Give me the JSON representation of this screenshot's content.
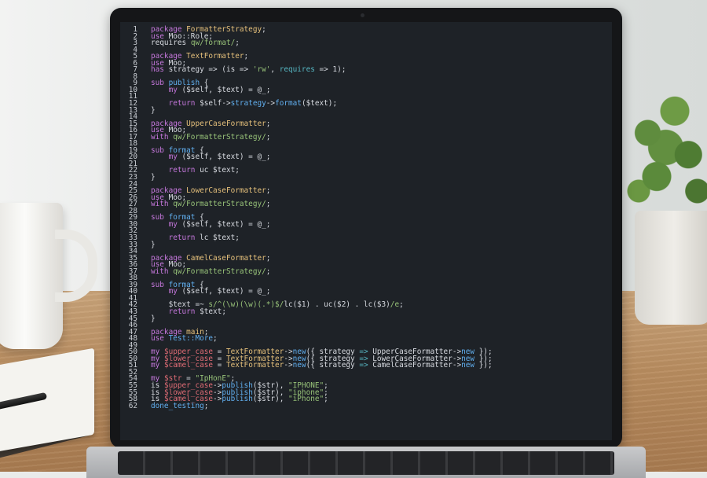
{
  "scene": {
    "objects": [
      "coffee-mug",
      "notebook",
      "pen",
      "potted-plant",
      "laptop"
    ]
  },
  "editor": {
    "theme": "dark",
    "background": "#1e2227",
    "colors": {
      "keyword": "#c678dd",
      "type": "#e5c07b",
      "string": "#98c379",
      "function": "#61afef",
      "variable": "#e06c75",
      "operator": "#56b6c2",
      "plain": "#d7dae0"
    },
    "lines": [
      {
        "n": "1",
        "segs": [
          [
            "kw",
            "package "
          ],
          [
            "ty",
            "FormatterStrategy"
          ],
          [
            "pl",
            ";"
          ]
        ]
      },
      {
        "n": "2",
        "segs": [
          [
            "kw",
            "use "
          ],
          [
            "pl",
            "Moo::Role;"
          ]
        ]
      },
      {
        "n": "3",
        "segs": [
          [
            "pl",
            "requires "
          ],
          [
            "str",
            "qw/format/"
          ],
          [
            "pl",
            ";"
          ]
        ]
      },
      {
        "n": "4",
        "segs": []
      },
      {
        "n": "5",
        "segs": [
          [
            "kw",
            "package "
          ],
          [
            "ty",
            "TextFormatter"
          ],
          [
            "pl",
            ";"
          ]
        ]
      },
      {
        "n": "6",
        "segs": [
          [
            "kw",
            "use "
          ],
          [
            "pl",
            "Moo;"
          ]
        ]
      },
      {
        "n": "7",
        "segs": [
          [
            "kw",
            "has "
          ],
          [
            "pl",
            "strategy => (is => "
          ],
          [
            "str",
            "'rw'"
          ],
          [
            "pl",
            ", "
          ],
          [
            "op",
            "requires"
          ],
          [
            "pl",
            " => 1);"
          ]
        ]
      },
      {
        "n": "8",
        "segs": []
      },
      {
        "n": "9",
        "segs": [
          [
            "kw",
            "sub "
          ],
          [
            "fn",
            "publish"
          ],
          [
            "pl",
            " {"
          ]
        ]
      },
      {
        "n": "10",
        "segs": [
          [
            "pl",
            "    "
          ],
          [
            "kw",
            "my "
          ],
          [
            "pl",
            "($self, $text) = @_;"
          ]
        ]
      },
      {
        "n": "11",
        "segs": []
      },
      {
        "n": "12",
        "segs": [
          [
            "pl",
            "    "
          ],
          [
            "kw",
            "return "
          ],
          [
            "pl",
            "$self->"
          ],
          [
            "fn",
            "strategy"
          ],
          [
            "pl",
            "->"
          ],
          [
            "fn",
            "format"
          ],
          [
            "pl",
            "($text);"
          ]
        ]
      },
      {
        "n": "13",
        "segs": [
          [
            "pl",
            "}"
          ]
        ]
      },
      {
        "n": "14",
        "segs": []
      },
      {
        "n": "15",
        "segs": [
          [
            "kw",
            "package "
          ],
          [
            "ty",
            "UpperCaseFormatter"
          ],
          [
            "pl",
            ";"
          ]
        ]
      },
      {
        "n": "16",
        "segs": [
          [
            "kw",
            "use "
          ],
          [
            "pl",
            "Moo;"
          ]
        ]
      },
      {
        "n": "17",
        "segs": [
          [
            "kw",
            "with "
          ],
          [
            "str",
            "qw/FormatterStrategy/"
          ],
          [
            "pl",
            ";"
          ]
        ]
      },
      {
        "n": "18",
        "segs": []
      },
      {
        "n": "19",
        "segs": [
          [
            "kw",
            "sub "
          ],
          [
            "fn",
            "format"
          ],
          [
            "pl",
            " {"
          ]
        ]
      },
      {
        "n": "20",
        "segs": [
          [
            "pl",
            "    "
          ],
          [
            "kw",
            "my "
          ],
          [
            "pl",
            "($self, $text) = @_;"
          ]
        ]
      },
      {
        "n": "21",
        "segs": []
      },
      {
        "n": "22",
        "segs": [
          [
            "pl",
            "    "
          ],
          [
            "kw",
            "return "
          ],
          [
            "pl",
            "uc $text;"
          ]
        ]
      },
      {
        "n": "23",
        "segs": [
          [
            "pl",
            "}"
          ]
        ]
      },
      {
        "n": "24",
        "segs": []
      },
      {
        "n": "25",
        "segs": [
          [
            "kw",
            "package "
          ],
          [
            "ty",
            "LowerCaseFormatter"
          ],
          [
            "pl",
            ";"
          ]
        ]
      },
      {
        "n": "26",
        "segs": [
          [
            "kw",
            "use "
          ],
          [
            "pl",
            "Moo;"
          ]
        ]
      },
      {
        "n": "27",
        "segs": [
          [
            "kw",
            "with "
          ],
          [
            "str",
            "qw/FormatterStrategy/"
          ],
          [
            "pl",
            ";"
          ]
        ]
      },
      {
        "n": "28",
        "segs": []
      },
      {
        "n": "29",
        "segs": [
          [
            "kw",
            "sub "
          ],
          [
            "fn",
            "format"
          ],
          [
            "pl",
            " {"
          ]
        ]
      },
      {
        "n": "30",
        "segs": [
          [
            "pl",
            "    "
          ],
          [
            "kw",
            "my "
          ],
          [
            "pl",
            "($self, $text) = @_;"
          ]
        ]
      },
      {
        "n": "32",
        "segs": []
      },
      {
        "n": "33",
        "segs": [
          [
            "pl",
            "    "
          ],
          [
            "kw",
            "return "
          ],
          [
            "pl",
            "lc $text;"
          ]
        ]
      },
      {
        "n": "33",
        "segs": [
          [
            "pl",
            "}"
          ]
        ]
      },
      {
        "n": "34",
        "segs": []
      },
      {
        "n": "35",
        "segs": [
          [
            "kw",
            "package "
          ],
          [
            "ty",
            "CamelCaseFormatter"
          ],
          [
            "pl",
            ";"
          ]
        ]
      },
      {
        "n": "36",
        "segs": [
          [
            "kw",
            "use "
          ],
          [
            "pl",
            "Moo;"
          ]
        ]
      },
      {
        "n": "37",
        "segs": [
          [
            "kw",
            "with "
          ],
          [
            "str",
            "qw/FormatterStrategy/"
          ],
          [
            "pl",
            ";"
          ]
        ]
      },
      {
        "n": "38",
        "segs": []
      },
      {
        "n": "39",
        "segs": [
          [
            "kw",
            "sub "
          ],
          [
            "fn",
            "format"
          ],
          [
            "pl",
            " {"
          ]
        ]
      },
      {
        "n": "40",
        "segs": [
          [
            "pl",
            "    "
          ],
          [
            "kw",
            "my "
          ],
          [
            "pl",
            "($self, $text) = @_;"
          ]
        ]
      },
      {
        "n": "41",
        "segs": []
      },
      {
        "n": "42",
        "segs": [
          [
            "pl",
            "    $text =~ "
          ],
          [
            "str",
            "s/^(\\w)(\\w)(.*)$/"
          ],
          [
            "pl",
            "lc($1) . uc($2) . lc($3)"
          ],
          [
            "str",
            "/e"
          ],
          [
            "pl",
            ";"
          ]
        ]
      },
      {
        "n": "43",
        "segs": [
          [
            "pl",
            "    "
          ],
          [
            "kw",
            "return "
          ],
          [
            "pl",
            "$text;"
          ]
        ]
      },
      {
        "n": "45",
        "segs": [
          [
            "pl",
            "}"
          ]
        ]
      },
      {
        "n": "46",
        "segs": []
      },
      {
        "n": "47",
        "segs": [
          [
            "kw",
            "package "
          ],
          [
            "ty",
            "main"
          ],
          [
            "pl",
            ";"
          ]
        ]
      },
      {
        "n": "48",
        "segs": [
          [
            "kw",
            "use "
          ],
          [
            "fn",
            "Test::More"
          ],
          [
            "pl",
            ";"
          ]
        ]
      },
      {
        "n": "49",
        "segs": []
      },
      {
        "n": "50",
        "segs": [
          [
            "kw",
            "my "
          ],
          [
            "var",
            "$upper_case"
          ],
          [
            "pl",
            " = "
          ],
          [
            "ty",
            "TextFormatter"
          ],
          [
            "pl",
            "->"
          ],
          [
            "fn",
            "new"
          ],
          [
            "pl",
            "({ strategy "
          ],
          [
            "op",
            "=>"
          ],
          [
            "pl",
            " UpperCaseFormatter->"
          ],
          [
            "fn",
            "new"
          ],
          [
            "pl",
            " });"
          ]
        ]
      },
      {
        "n": "50",
        "segs": [
          [
            "kw",
            "my "
          ],
          [
            "var",
            "$lower_case"
          ],
          [
            "pl",
            " = "
          ],
          [
            "ty",
            "TextFormatter"
          ],
          [
            "pl",
            "->"
          ],
          [
            "fn",
            "new"
          ],
          [
            "pl",
            "({ strategy "
          ],
          [
            "op",
            "=>"
          ],
          [
            "pl",
            " LowerCaseFormatter->"
          ],
          [
            "fn",
            "new"
          ],
          [
            "pl",
            " });"
          ]
        ]
      },
      {
        "n": "51",
        "segs": [
          [
            "kw",
            "my "
          ],
          [
            "var",
            "$camel_case"
          ],
          [
            "pl",
            " = "
          ],
          [
            "ty",
            "TextFormatter"
          ],
          [
            "pl",
            "->"
          ],
          [
            "fn",
            "new"
          ],
          [
            "pl",
            "({ strategy "
          ],
          [
            "op",
            "=>"
          ],
          [
            "pl",
            " CamelCaseFormatter->"
          ],
          [
            "fn",
            "new"
          ],
          [
            "pl",
            " });"
          ]
        ]
      },
      {
        "n": "52",
        "segs": []
      },
      {
        "n": "54",
        "segs": [
          [
            "kw",
            "my "
          ],
          [
            "var",
            "$str"
          ],
          [
            "pl",
            " = "
          ],
          [
            "str",
            "\"IpHonE\""
          ],
          [
            "pl",
            ";"
          ]
        ]
      },
      {
        "n": "55",
        "segs": [
          [
            "pl",
            "is "
          ],
          [
            "var",
            "$upper_case"
          ],
          [
            "pl",
            "->"
          ],
          [
            "fn",
            "publish"
          ],
          [
            "pl",
            "($str), "
          ],
          [
            "str",
            "\"IPHONE\""
          ],
          [
            "pl",
            ";"
          ]
        ]
      },
      {
        "n": "55",
        "segs": [
          [
            "pl",
            "is "
          ],
          [
            "var",
            "$lower_case"
          ],
          [
            "pl",
            "->"
          ],
          [
            "fn",
            "publish"
          ],
          [
            "pl",
            "($str), "
          ],
          [
            "str",
            "\"iphone\""
          ],
          [
            "pl",
            ";"
          ]
        ]
      },
      {
        "n": "58",
        "segs": [
          [
            "pl",
            "is "
          ],
          [
            "var",
            "$camel_case"
          ],
          [
            "pl",
            "->"
          ],
          [
            "fn",
            "publish"
          ],
          [
            "pl",
            "($str), "
          ],
          [
            "str",
            "\"iPhone\""
          ],
          [
            "pl",
            ";"
          ]
        ]
      },
      {
        "n": "62",
        "segs": [
          [
            "fn",
            "done_testing"
          ],
          [
            "pl",
            ";"
          ]
        ]
      }
    ]
  }
}
